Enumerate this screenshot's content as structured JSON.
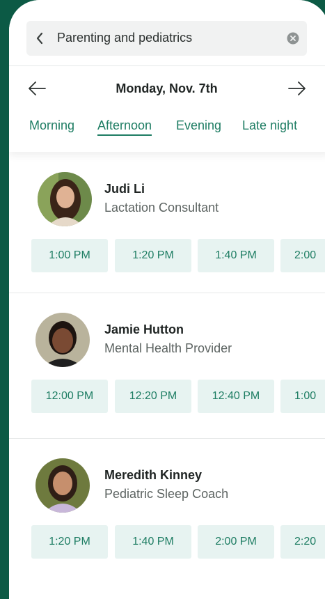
{
  "search": {
    "query": "Parenting and pediatrics"
  },
  "date": {
    "label": "Monday, Nov. 7th"
  },
  "tabs": [
    {
      "label": "Morning",
      "active": false
    },
    {
      "label": "Afternoon",
      "active": true
    },
    {
      "label": "Evening",
      "active": false
    },
    {
      "label": "Late night",
      "active": false
    }
  ],
  "providers": [
    {
      "name": "Judi Li",
      "role": "Lactation Consultant",
      "slots": [
        "1:00 PM",
        "1:20 PM",
        "1:40 PM",
        "2:00"
      ]
    },
    {
      "name": "Jamie Hutton",
      "role": "Mental Health Provider",
      "slots": [
        "12:00 PM",
        "12:20 PM",
        "12:40 PM",
        "1:00"
      ]
    },
    {
      "name": "Meredith Kinney",
      "role": "Pediatric Sleep Coach",
      "slots": [
        "1:20 PM",
        "1:40 PM",
        "2:00 PM",
        "2:20"
      ]
    }
  ],
  "colors": {
    "brand": "#0c5a45",
    "accent": "#1e7d63",
    "slot_bg": "#e7f3f1"
  }
}
